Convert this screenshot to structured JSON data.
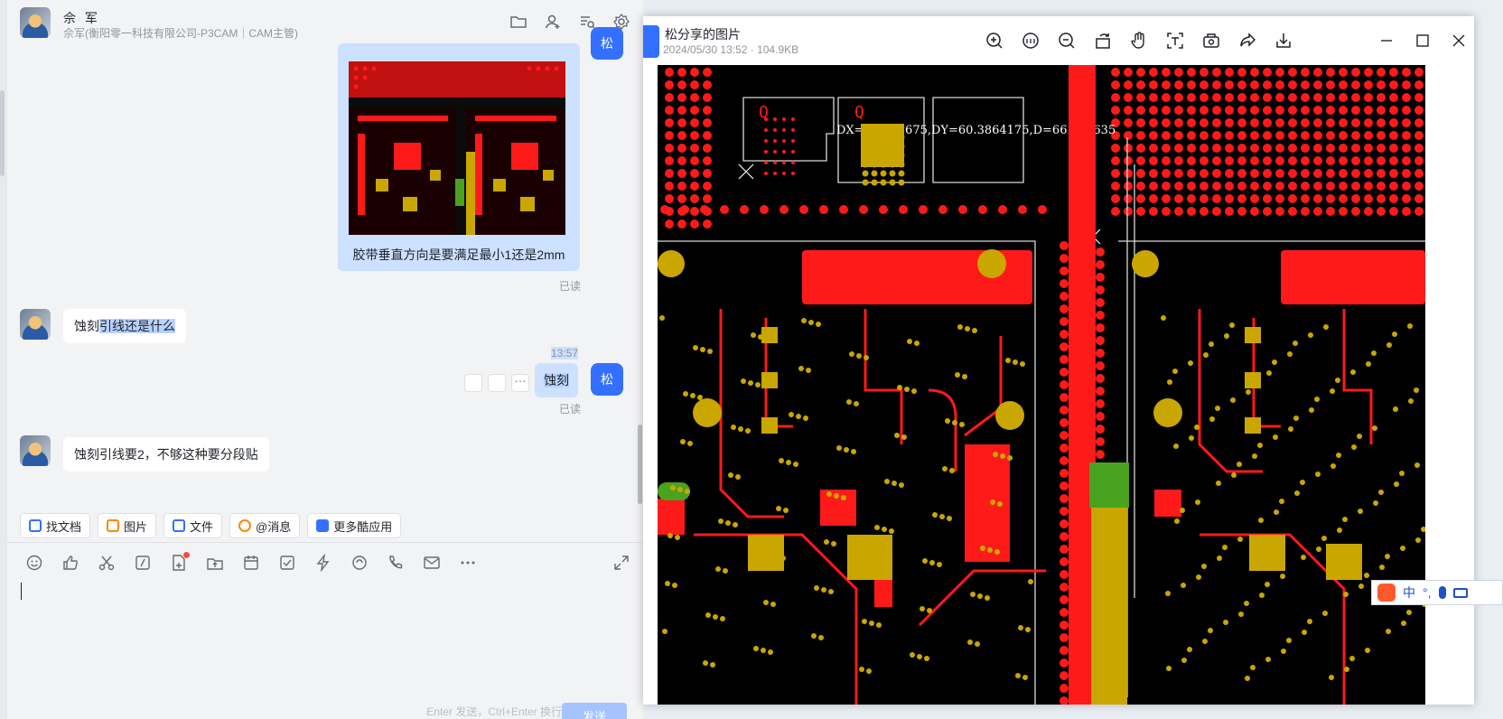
{
  "chat": {
    "header": {
      "name": "佘 军",
      "subtitle": "佘军(衡阳零一科技有限公司-P3CAM｜CAM主管)"
    },
    "self_avatar_label": "松",
    "messages": {
      "image_caption": "胶带垂直方向是要满足最小1还是2mm",
      "read1": "已读",
      "msg_in_1": "蚀刻引线还是什么",
      "msg_in_1_plain": "蚀刻",
      "msg_in_1_hl": "引线还是什么",
      "time": "13:57",
      "msg_out_1": "蚀刻",
      "read2": "已读",
      "msg_in_2": "蚀刻引线要2，不够这种要分段贴"
    },
    "tools": [
      {
        "label": "找文档",
        "color": "#3370ff"
      },
      {
        "label": "图片",
        "color": "#ff8800"
      },
      {
        "label": "文件",
        "color": "#3370ff"
      },
      {
        "label": "@消息",
        "color": "#ff8800"
      },
      {
        "label": "更多酷应用",
        "color": "#3370ff"
      }
    ],
    "editor": {
      "send_hint": "Enter 发送，Ctrl+Enter 换行",
      "send_label": "发送"
    }
  },
  "viewer": {
    "title": "松分享的图片",
    "meta": "2024/05/30 13:52 · 104.9KB",
    "measure_text": "DX=0.9803675,DY=60.3864175,D=66.573635",
    "colors": {
      "copper": "#ff1a1a",
      "pad": "#c9a700",
      "board": "#000000",
      "green": "#4aa31f"
    }
  },
  "ime": {
    "mode": "中",
    "punct": "°,"
  }
}
